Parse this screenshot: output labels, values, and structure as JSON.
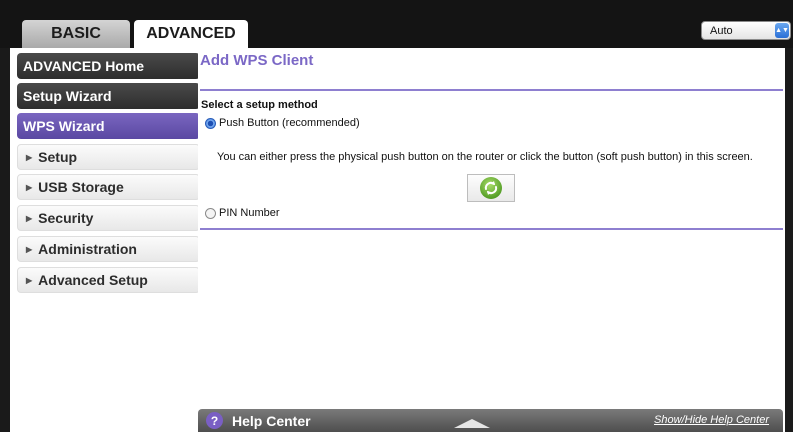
{
  "tabs": {
    "basic": "BASIC",
    "advanced": "ADVANCED"
  },
  "refresh_select": {
    "value": "Auto"
  },
  "sidebar": {
    "items": [
      {
        "label": "ADVANCED Home",
        "style": "dark"
      },
      {
        "label": "Setup Wizard",
        "style": "dark"
      },
      {
        "label": "WPS Wizard",
        "style": "active"
      },
      {
        "label": "Setup",
        "style": "expandable"
      },
      {
        "label": "USB Storage",
        "style": "expandable"
      },
      {
        "label": "Security",
        "style": "expandable"
      },
      {
        "label": "Administration",
        "style": "expandable"
      },
      {
        "label": "Advanced Setup",
        "style": "expandable"
      }
    ]
  },
  "main": {
    "title": "Add WPS Client",
    "section_label": "Select a setup method",
    "options": {
      "push_button": "Push Button (recommended)",
      "pin_number": "PIN Number"
    },
    "selected_option": "push_button",
    "push_description": "You can either press the physical push button on the router or click the button (soft push button) in this screen.",
    "wps_button_icon": "wps-push-icon"
  },
  "help": {
    "label": "Help Center",
    "toggle": "Show/Hide Help Center"
  },
  "colors": {
    "accent_purple": "#7b68c6",
    "active_nav": "#6653b0",
    "dark_nav": "#3a3a3a",
    "wps_green": "#6bb238"
  }
}
